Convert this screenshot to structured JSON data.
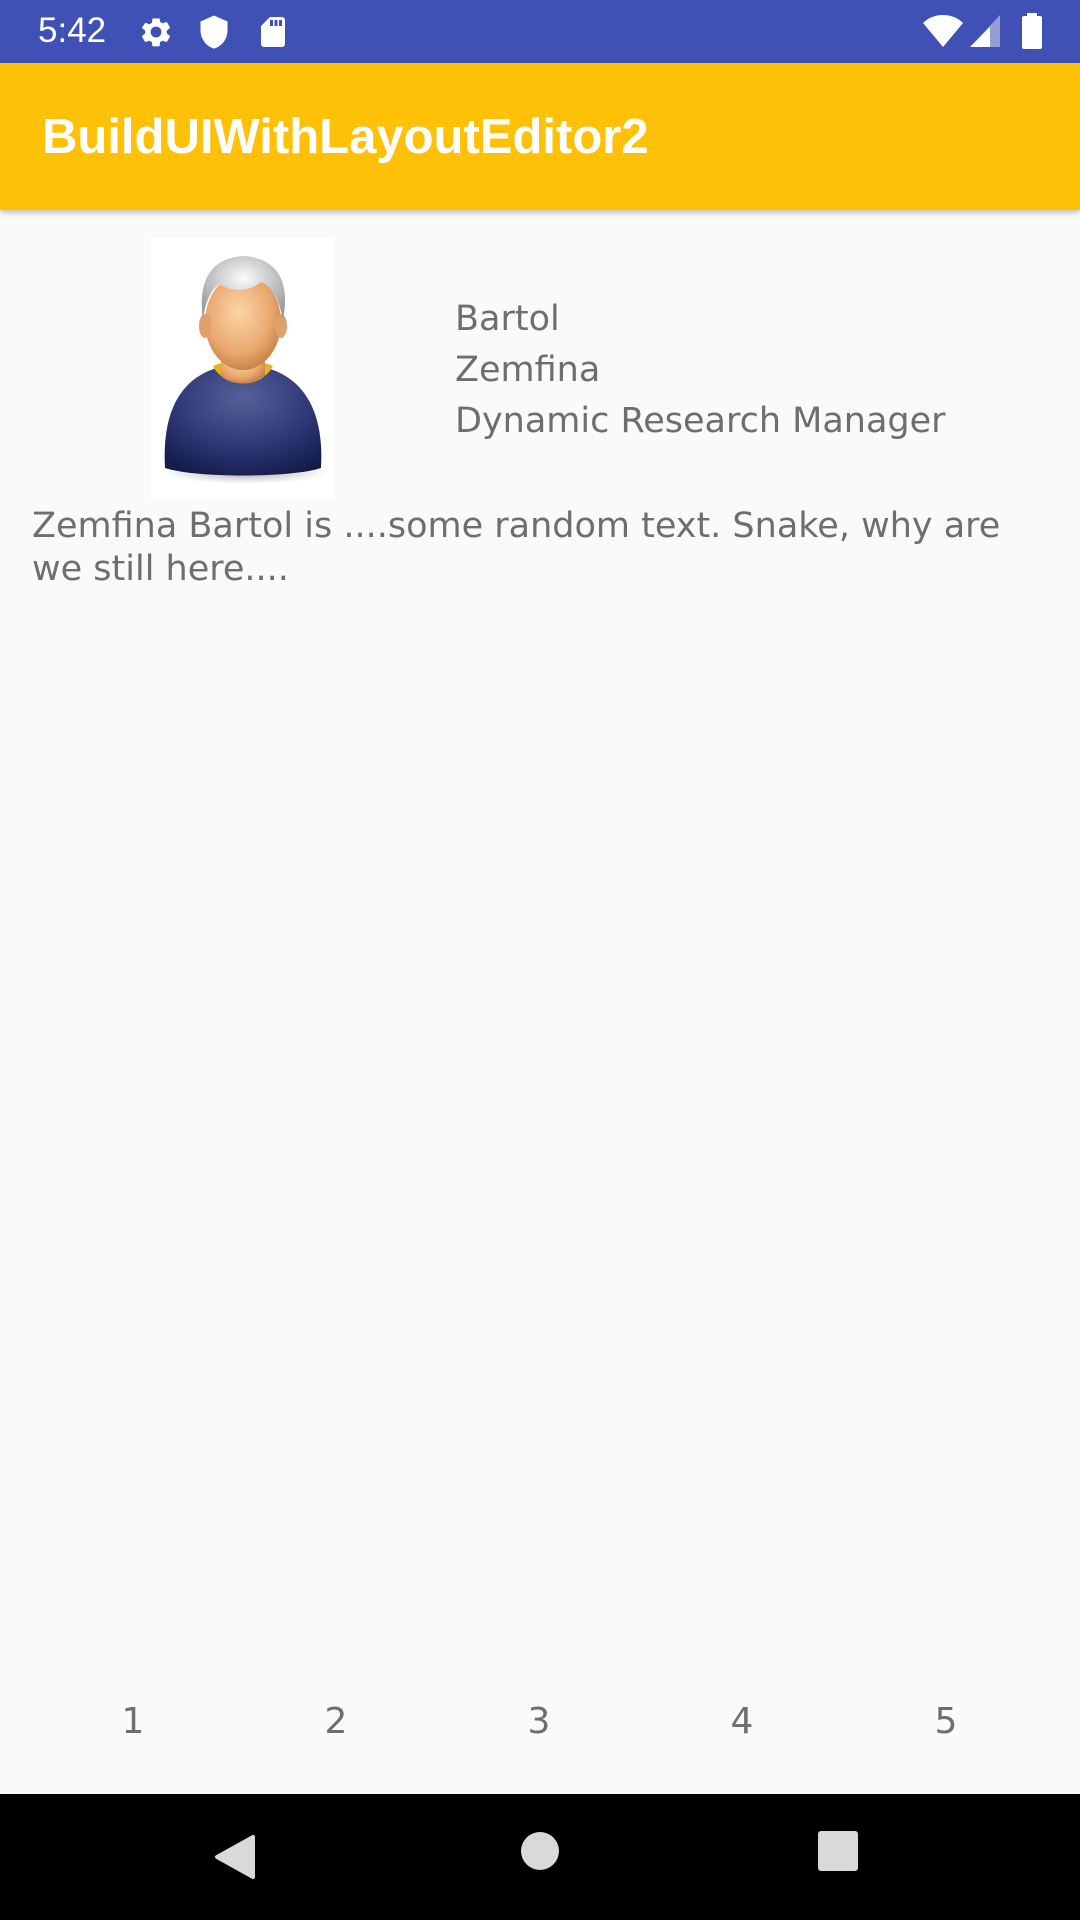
{
  "status_bar": {
    "time": "5:42",
    "icons": [
      "gear-icon",
      "shield-icon",
      "sd-card-icon",
      "wifi-icon",
      "cell-signal-icon",
      "battery-icon"
    ],
    "background_color": "#3f51b5"
  },
  "app_bar": {
    "title": "BuildUIWithLayoutEditor2",
    "background_color": "#ffc107"
  },
  "profile": {
    "avatar_icon": "user-avatar-icon",
    "last_name": "Bartol",
    "first_name": "Zemfina",
    "job_title": "Dynamic Research Manager",
    "description": "Zemfina Bartol is ....some random text. Snake, why are we still here...."
  },
  "tabs": [
    "1",
    "2",
    "3",
    "4",
    "5"
  ],
  "nav_bar": {
    "icons": [
      "back-icon",
      "home-icon",
      "recents-icon"
    ]
  }
}
